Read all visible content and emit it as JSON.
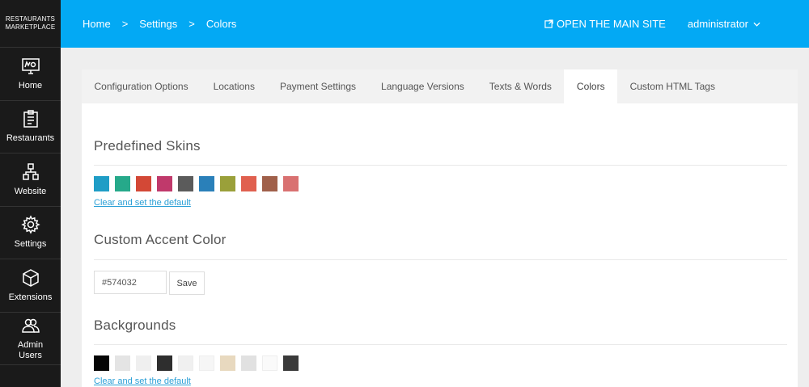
{
  "brand": {
    "line1": "RESTAURANTS",
    "line2": "MARKETPLACE"
  },
  "sidebar": {
    "items": [
      {
        "label": "Home",
        "icon": "presentation-board-icon"
      },
      {
        "label": "Restaurants",
        "icon": "clipboard-icon"
      },
      {
        "label": "Website",
        "icon": "sitemap-icon"
      },
      {
        "label": "Settings",
        "icon": "gear-icon"
      },
      {
        "label": "Extensions",
        "icon": "cube-icon"
      },
      {
        "label": "Admin",
        "label2": "Users",
        "icon": "users-icon"
      }
    ]
  },
  "header": {
    "breadcrumb": [
      "Home",
      "Settings",
      "Colors"
    ],
    "separator": ">",
    "site_link": "OPEN THE MAIN SITE",
    "user": "administrator"
  },
  "tabs": [
    {
      "label": "Configuration Options",
      "active": false
    },
    {
      "label": "Locations",
      "active": false
    },
    {
      "label": "Payment Settings",
      "active": false
    },
    {
      "label": "Language Versions",
      "active": false
    },
    {
      "label": "Texts & Words",
      "active": false
    },
    {
      "label": "Colors",
      "active": true
    },
    {
      "label": "Custom HTML Tags",
      "active": false
    }
  ],
  "skins": {
    "title": "Predefined Skins",
    "colors": [
      "#1f9dc6",
      "#26a98a",
      "#d34836",
      "#c0396b",
      "#5b5b5b",
      "#2a80b9",
      "#9aa03a",
      "#e0604f",
      "#a0604a",
      "#d97171"
    ],
    "clear_link": "Clear and set the default"
  },
  "accent": {
    "title": "Custom Accent Color",
    "value": "#574032",
    "save_label": "Save"
  },
  "backgrounds": {
    "title": "Backgrounds",
    "colors": [
      "#050505",
      "#e4e4e4",
      "#efefef",
      "#2e2e2e",
      "#f0f0f0",
      "#f6f6f6",
      "#e8d9bf",
      "#e1e1e1",
      "#fafafa",
      "#3a3a3a"
    ],
    "clear_link": "Clear and set the default"
  }
}
